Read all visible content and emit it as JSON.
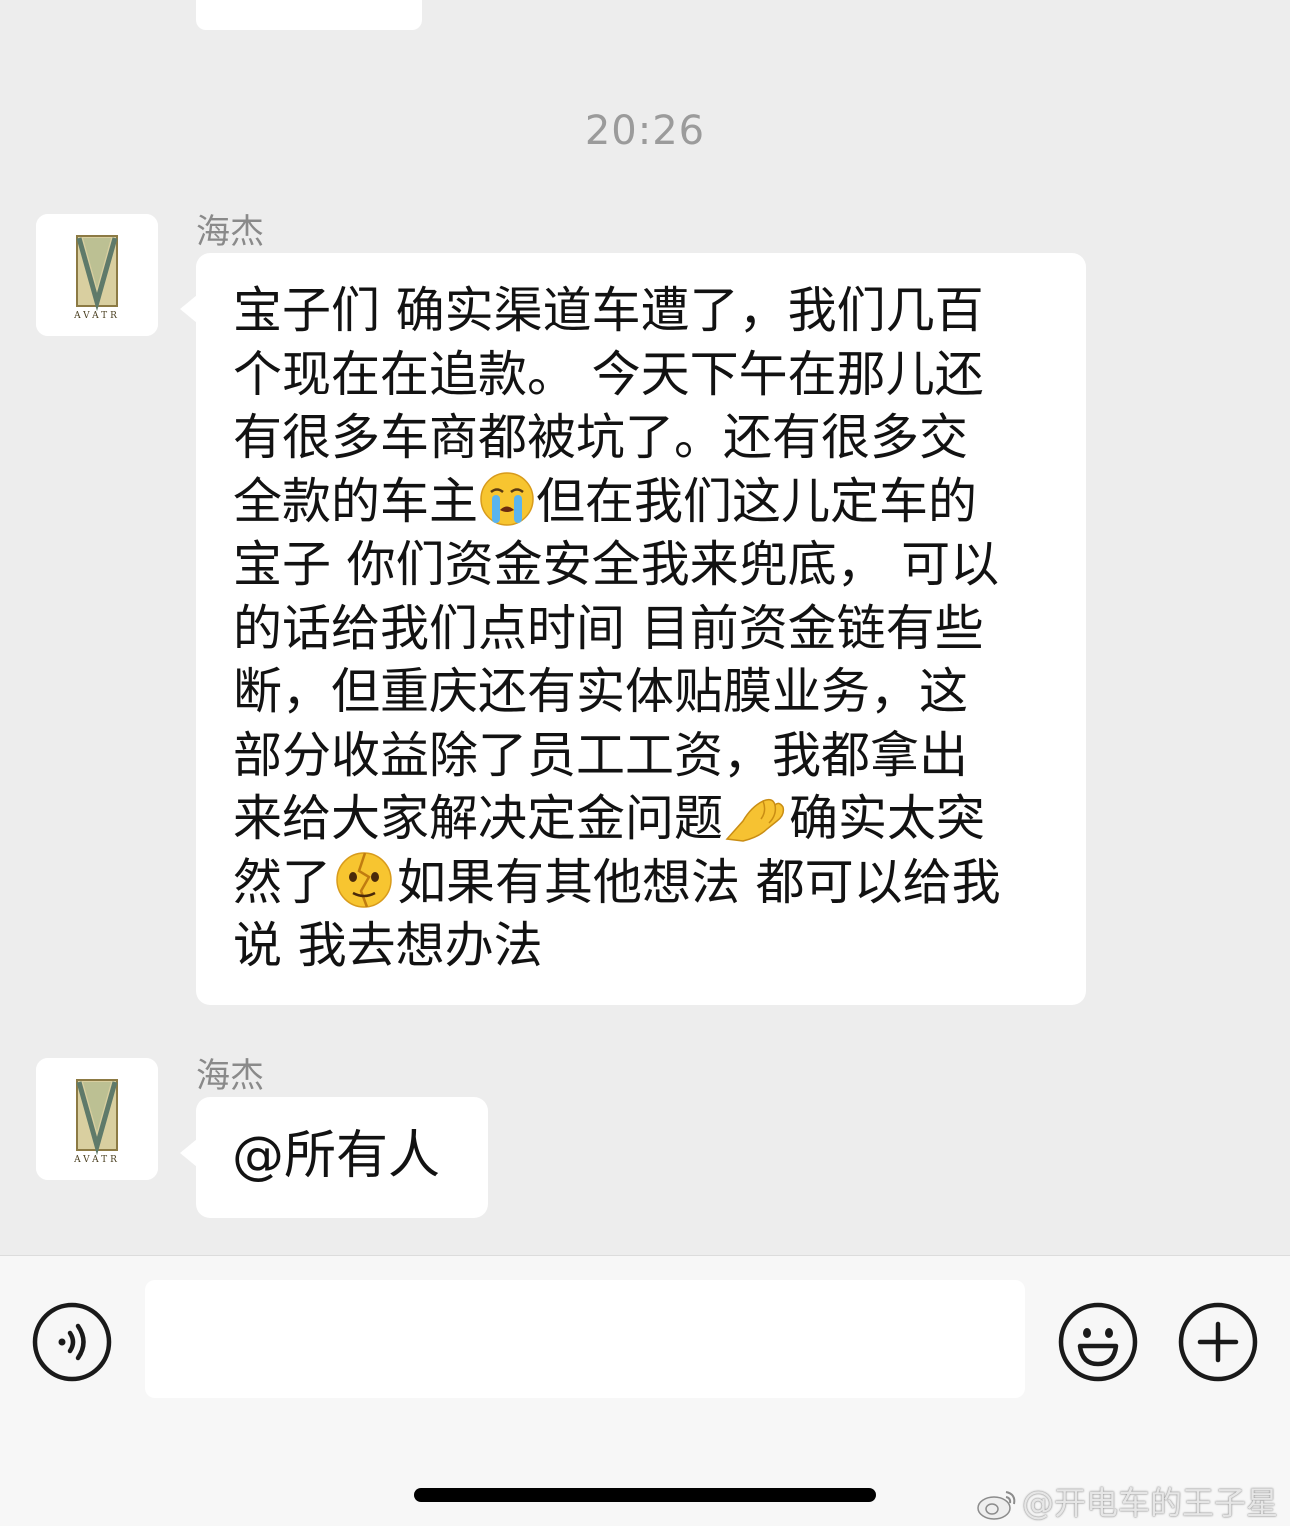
{
  "chat": {
    "timestamp": "20:26",
    "messages": [
      {
        "sender": "海杰",
        "avatar_text": "AVATR",
        "lines": [
          [
            "宝子们  确实渠道车遭了，我们几百"
          ],
          [
            "个现在在追款。 今天下午在那儿还"
          ],
          [
            "有很多车商都被坑了。还有很多交"
          ],
          [
            "全款的车主",
            "但在我们这儿定车的"
          ],
          [
            "宝子  你们资金安全我来兜底，  可以"
          ],
          [
            "的话给我们点时间 目前资金链有些"
          ],
          [
            "断，但重庆还有实体贴膜业务，这"
          ],
          [
            "部分收益除了员工工资，我都拿出"
          ],
          [
            "来给大家解决定金问题",
            "确实太突"
          ],
          [
            "然了",
            "如果有其他想法 都可以给我"
          ],
          [
            "说 我去想办法"
          ]
        ],
        "emojis": [
          "crying-face",
          "pinched-fingers",
          "broken-heart-face"
        ]
      },
      {
        "sender": "海杰",
        "avatar_text": "AVATR",
        "text": "@所有人"
      }
    ]
  },
  "input_bar": {
    "voice_icon": "voice-icon",
    "text_value": "",
    "emoji_icon": "smiley-icon",
    "plus_icon": "plus-icon"
  },
  "watermark": {
    "text": "@开电车的王子星",
    "icon": "weibo-icon"
  }
}
